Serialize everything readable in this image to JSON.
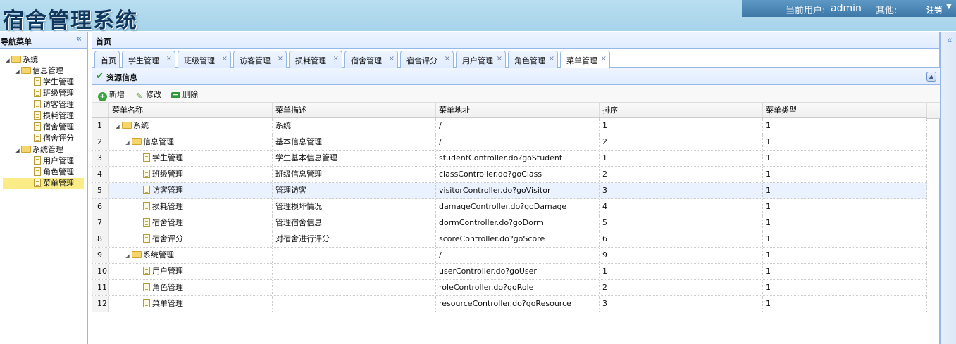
{
  "header": {
    "app_title": "宿舍管理系统",
    "current_user_label": "当前用户:",
    "current_user": "admin",
    "other_label": "其他:",
    "logout_label": "注销"
  },
  "nav": {
    "title": "导航菜单",
    "tree": [
      {
        "label": "系统",
        "level": 0,
        "type": "folder"
      },
      {
        "label": "信息管理",
        "level": 1,
        "type": "folder"
      },
      {
        "label": "学生管理",
        "level": 2,
        "type": "file"
      },
      {
        "label": "班级管理",
        "level": 2,
        "type": "file"
      },
      {
        "label": "访客管理",
        "level": 2,
        "type": "file"
      },
      {
        "label": "损耗管理",
        "level": 2,
        "type": "file"
      },
      {
        "label": "宿舍管理",
        "level": 2,
        "type": "file"
      },
      {
        "label": "宿舍评分",
        "level": 2,
        "type": "file"
      },
      {
        "label": "系统管理",
        "level": 1,
        "type": "folder"
      },
      {
        "label": "用户管理",
        "level": 2,
        "type": "file"
      },
      {
        "label": "角色管理",
        "level": 2,
        "type": "file"
      },
      {
        "label": "菜单管理",
        "level": 2,
        "type": "file",
        "selected": true
      }
    ]
  },
  "center": {
    "title": "首页",
    "tabs": [
      {
        "label": "首页",
        "closable": false
      },
      {
        "label": "学生管理",
        "closable": true
      },
      {
        "label": "班级管理",
        "closable": true
      },
      {
        "label": "访客管理",
        "closable": true
      },
      {
        "label": "损耗管理",
        "closable": true
      },
      {
        "label": "宿舍管理",
        "closable": true
      },
      {
        "label": "宿舍评分",
        "closable": true
      },
      {
        "label": "用户管理",
        "closable": true
      },
      {
        "label": "角色管理",
        "closable": true
      },
      {
        "label": "菜单管理",
        "closable": true,
        "active": true
      }
    ]
  },
  "panel": {
    "title": "资源信息",
    "toolbar": {
      "add_label": "新增",
      "edit_label": "修改",
      "delete_label": "删除"
    }
  },
  "grid": {
    "columns": [
      "菜单名称",
      "菜单描述",
      "菜单地址",
      "排序",
      "菜单类型"
    ],
    "rows": [
      {
        "num": "1",
        "name": "系统",
        "level": 0,
        "type": "folder",
        "desc": "系统",
        "url": "/",
        "sort": "1",
        "mtype": "1"
      },
      {
        "num": "2",
        "name": "信息管理",
        "level": 1,
        "type": "folder",
        "desc": "基本信息管理",
        "url": "/",
        "sort": "2",
        "mtype": "1"
      },
      {
        "num": "3",
        "name": "学生管理",
        "level": 2,
        "type": "file",
        "desc": "学生基本信息管理",
        "url": "studentController.do?goStudent",
        "sort": "1",
        "mtype": "1"
      },
      {
        "num": "4",
        "name": "班级管理",
        "level": 2,
        "type": "file",
        "desc": "班级信息管理",
        "url": "classController.do?goClass",
        "sort": "2",
        "mtype": "1"
      },
      {
        "num": "5",
        "name": "访客管理",
        "level": 2,
        "type": "file",
        "desc": "管理访客",
        "url": "visitorController.do?goVisitor",
        "sort": "3",
        "mtype": "1",
        "highlight": true
      },
      {
        "num": "6",
        "name": "损耗管理",
        "level": 2,
        "type": "file",
        "desc": "管理损坏情况",
        "url": "damageController.do?goDamage",
        "sort": "4",
        "mtype": "1"
      },
      {
        "num": "7",
        "name": "宿舍管理",
        "level": 2,
        "type": "file",
        "desc": "管理宿舍信息",
        "url": "dormController.do?goDorm",
        "sort": "5",
        "mtype": "1"
      },
      {
        "num": "8",
        "name": "宿舍评分",
        "level": 2,
        "type": "file",
        "desc": "对宿舍进行评分",
        "url": "scoreController.do?goScore",
        "sort": "6",
        "mtype": "1"
      },
      {
        "num": "9",
        "name": "系统管理",
        "level": 1,
        "type": "folder",
        "desc": "",
        "url": "/",
        "sort": "9",
        "mtype": "1"
      },
      {
        "num": "10",
        "name": "用户管理",
        "level": 2,
        "type": "file",
        "desc": "",
        "url": "userController.do?goUser",
        "sort": "1",
        "mtype": "1"
      },
      {
        "num": "11",
        "name": "角色管理",
        "level": 2,
        "type": "file",
        "desc": "",
        "url": "roleController.do?goRole",
        "sort": "2",
        "mtype": "1"
      },
      {
        "num": "12",
        "name": "菜单管理",
        "level": 2,
        "type": "file",
        "desc": "",
        "url": "resourceController.do?goResource",
        "sort": "3",
        "mtype": "1"
      }
    ]
  }
}
